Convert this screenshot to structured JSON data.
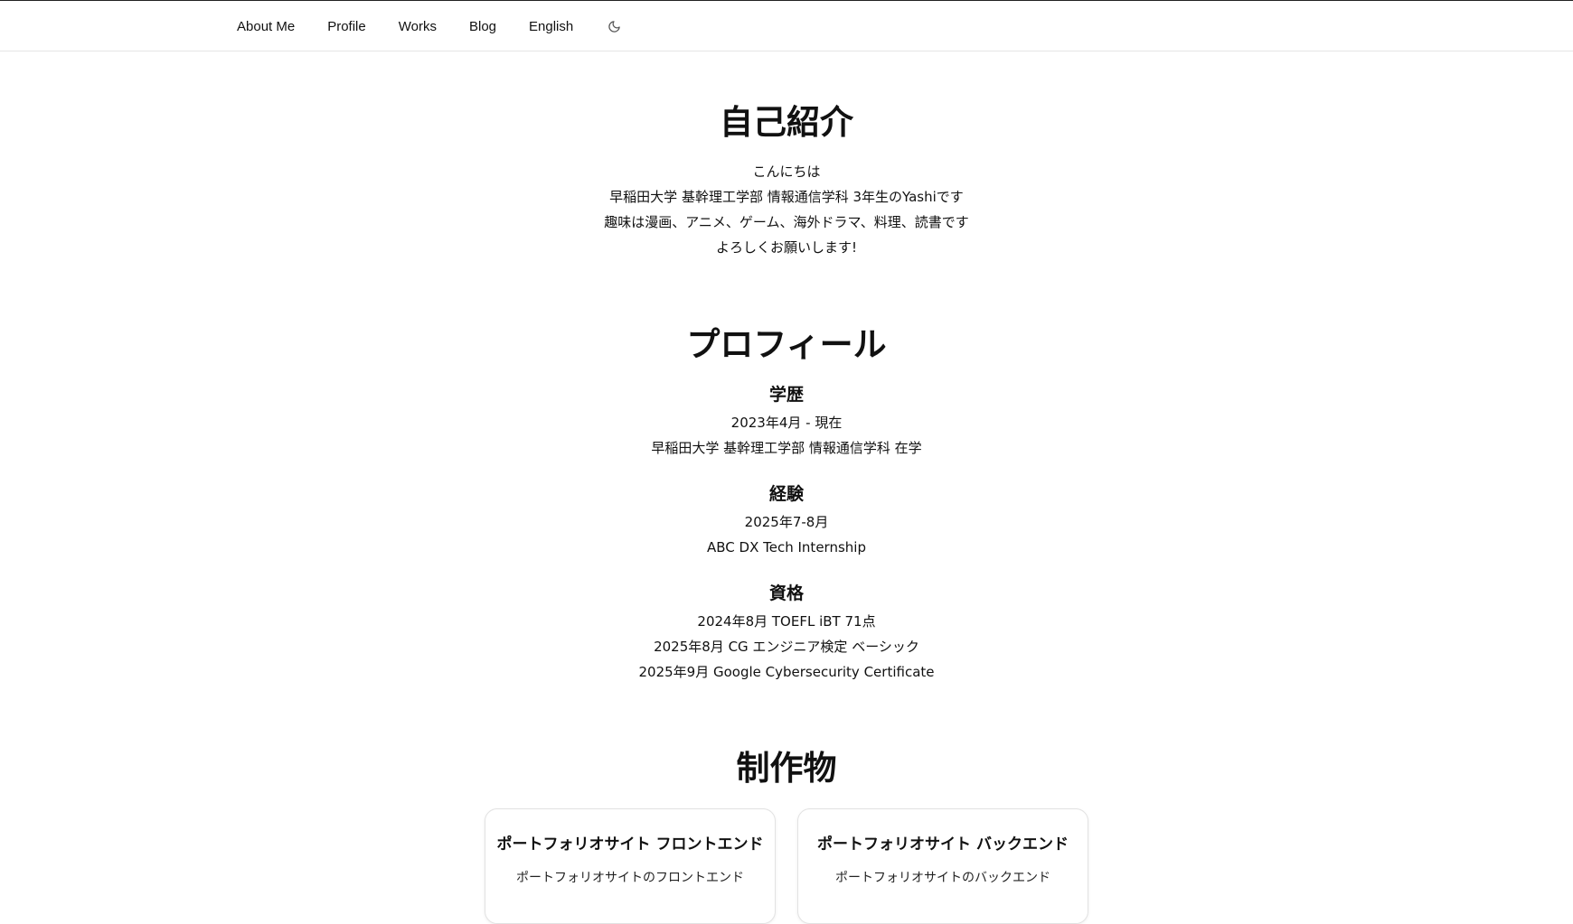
{
  "nav": {
    "items": [
      {
        "label": "About Me"
      },
      {
        "label": "Profile"
      },
      {
        "label": "Works"
      },
      {
        "label": "Blog"
      },
      {
        "label": "English"
      }
    ],
    "theme_icon": "moon-icon"
  },
  "about": {
    "title": "自己紹介",
    "lines": [
      "こんにちは",
      "早稲田大学 基幹理工学部 情報通信学科 3年生のYashiです",
      "趣味は漫画、アニメ、ゲーム、海外ドラマ、料理、読書です",
      "よろしくお願いします!"
    ]
  },
  "profile": {
    "title": "プロフィール",
    "education": {
      "heading": "学歴",
      "lines": [
        "2023年4月 - 現在",
        "早稲田大学 基幹理工学部 情報通信学科 在学"
      ]
    },
    "experience": {
      "heading": "経験",
      "lines": [
        "2025年7-8月",
        "ABC DX Tech Internship"
      ]
    },
    "certifications": {
      "heading": "資格",
      "lines": [
        "2024年8月 TOEFL iBT 71点",
        "2025年8月 CG エンジニア検定 ベーシック",
        "2025年9月 Google Cybersecurity Certificate"
      ]
    }
  },
  "works": {
    "title": "制作物",
    "cards": [
      {
        "title": "ポートフォリオサイト フロントエンド",
        "description": "ポートフォリオサイトのフロントエンド"
      },
      {
        "title": "ポートフォリオサイト バックエンド",
        "description": "ポートフォリオサイトのバックエンド"
      }
    ]
  }
}
